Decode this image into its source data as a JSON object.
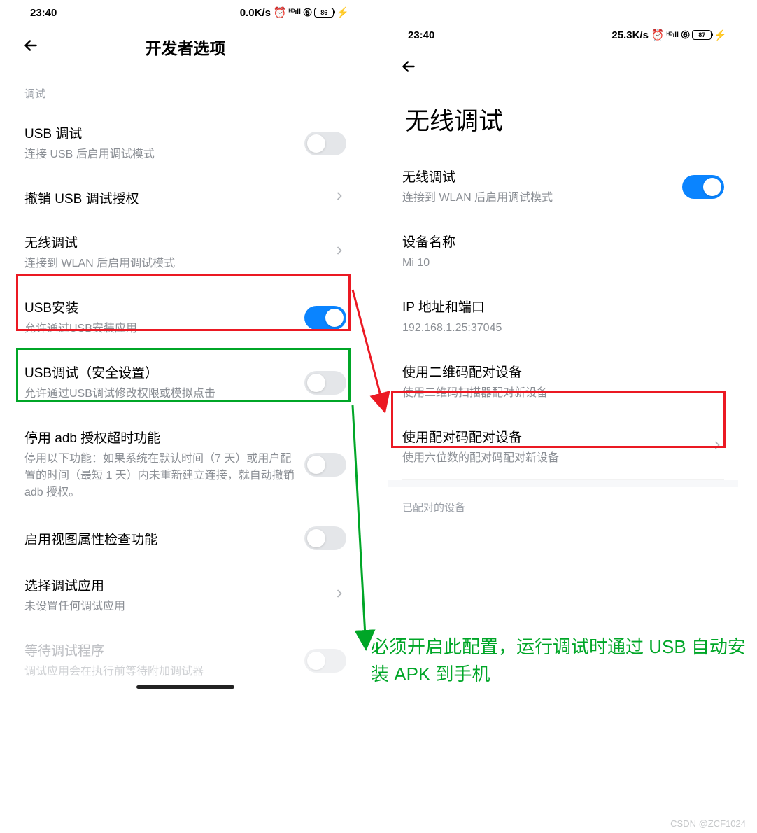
{
  "left": {
    "status": {
      "time": "23:40",
      "net": "0.0K/s",
      "battery": "86"
    },
    "header_title": "开发者选项",
    "section_label": "调试",
    "items": {
      "usb_debug": {
        "title": "USB 调试",
        "desc": "连接 USB 后启用调试模式"
      },
      "revoke": {
        "title": "撤销 USB 调试授权"
      },
      "wireless": {
        "title": "无线调试",
        "desc": "连接到 WLAN 后启用调试模式"
      },
      "usb_install": {
        "title": "USB安装",
        "desc": "允许通过USB安装应用"
      },
      "usb_debug_sec": {
        "title": "USB调试（安全设置）",
        "desc": "允许通过USB调试修改权限或模拟点击"
      },
      "adb_timeout": {
        "title": "停用 adb 授权超时功能",
        "desc": "停用以下功能：如果系统在默认时间（7 天）或用户配置的时间（最短 1 天）内未重新建立连接，就自动撤销 adb 授权。"
      },
      "view_attr": {
        "title": "启用视图属性检查功能"
      },
      "select_app": {
        "title": "选择调试应用",
        "desc": "未设置任何调试应用"
      },
      "wait_debugger": {
        "title": "等待调试程序",
        "desc": "调试应用会在执行前等待附加调试器"
      }
    }
  },
  "right": {
    "status": {
      "time": "23:40",
      "net": "25.3K/s",
      "battery": "87"
    },
    "big_title": "无线调试",
    "items": {
      "wireless": {
        "title": "无线调试",
        "desc": "连接到 WLAN 后启用调试模式"
      },
      "device_name": {
        "title": "设备名称",
        "desc": "Mi 10"
      },
      "ip_port": {
        "title": "IP 地址和端口",
        "desc": "192.168.1.25:37045"
      },
      "pair_qr": {
        "title": "使用二维码配对设备",
        "desc": "使用二维码扫描器配对新设备"
      },
      "pair_code": {
        "title": "使用配对码配对设备",
        "desc": "使用六位数的配对码配对新设备"
      }
    },
    "section_paired": "已配对的设备"
  },
  "annotation": "必须开启此配置，运行调试时通过 USB 自动安装 APK 到手机",
  "watermark": "CSDN @ZCF1024"
}
